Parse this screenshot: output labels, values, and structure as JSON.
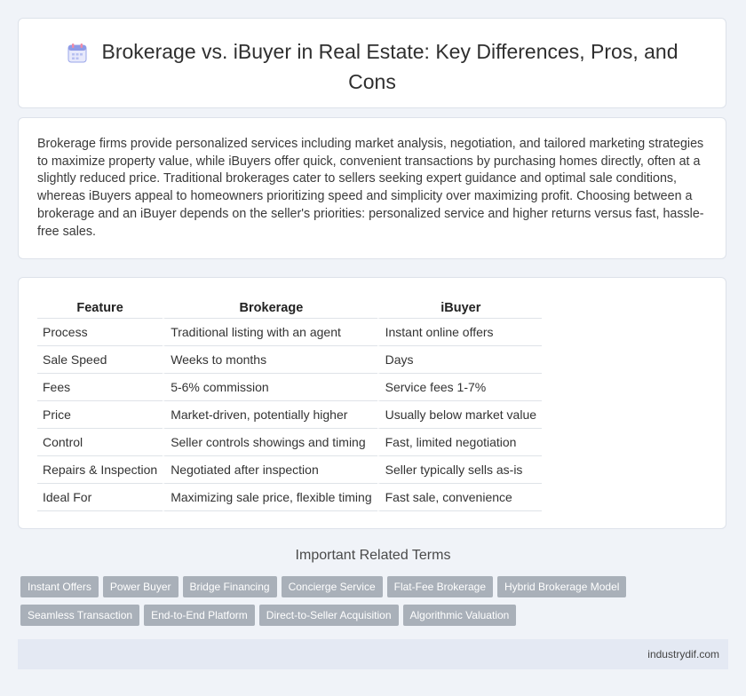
{
  "header": {
    "icon": "calendar-icon",
    "title": "Brokerage vs. iBuyer in Real Estate: Key Differences, Pros, and Cons"
  },
  "intro": {
    "text": "Brokerage firms provide personalized services including market analysis, negotiation, and tailored marketing strategies to maximize property value, while iBuyers offer quick, convenient transactions by purchasing homes directly, often at a slightly reduced price. Traditional brokerages cater to sellers seeking expert guidance and optimal sale conditions, whereas iBuyers appeal to homeowners prioritizing speed and simplicity over maximizing profit. Choosing between a brokerage and an iBuyer depends on the seller's priorities: personalized service and higher returns versus fast, hassle-free sales."
  },
  "table": {
    "headers": [
      "Feature",
      "Brokerage",
      "iBuyer"
    ],
    "rows": [
      [
        "Process",
        "Traditional listing with an agent",
        "Instant online offers"
      ],
      [
        "Sale Speed",
        "Weeks to months",
        "Days"
      ],
      [
        "Fees",
        "5-6% commission",
        "Service fees 1-7%"
      ],
      [
        "Price",
        "Market-driven, potentially higher",
        "Usually below market value"
      ],
      [
        "Control",
        "Seller controls showings and timing",
        "Fast, limited negotiation"
      ],
      [
        "Repairs & Inspection",
        "Negotiated after inspection",
        "Seller typically sells as-is"
      ],
      [
        "Ideal For",
        "Maximizing sale price, flexible timing",
        "Fast sale, convenience"
      ]
    ]
  },
  "related": {
    "title": "Important Related Terms",
    "tags": [
      "Instant Offers",
      "Power Buyer",
      "Bridge Financing",
      "Concierge Service",
      "Flat-Fee Brokerage",
      "Hybrid Brokerage Model",
      "Seamless Transaction",
      "End-to-End Platform",
      "Direct-to-Seller Acquisition",
      "Algorithmic Valuation"
    ]
  },
  "footer": {
    "site": "industrydif.com"
  },
  "colors": {
    "page_bg": "#f0f3f8",
    "tag_bg": "#a9b0b9",
    "footer_bg": "#e4e9f3",
    "icon_accent": "#7b8ce0"
  }
}
